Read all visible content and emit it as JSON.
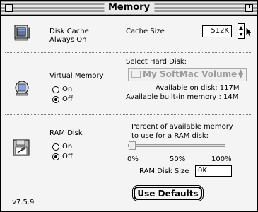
{
  "window": {
    "title": "Memory",
    "version": "v7.5.9"
  },
  "disk_cache": {
    "label_line1": "Disk Cache",
    "label_line2": "Always On",
    "cache_size_label": "Cache Size",
    "cache_size_value": "512K"
  },
  "virtual_memory": {
    "label": "Virtual Memory",
    "on_label": "On",
    "off_label": "Off",
    "selected": "Off",
    "select_disk_label": "Select Hard Disk:",
    "disk_popup_value": "My SoftMac Volume",
    "available_on_disk": "Available on disk:  117M",
    "available_builtin": "Available built-in memory :  14M"
  },
  "ram_disk": {
    "label": "RAM Disk",
    "on_label": "On",
    "off_label": "Off",
    "selected": "Off",
    "percent_label_line1": "Percent of available memory",
    "percent_label_line2": "to use for a RAM disk:",
    "tick_0": "0%",
    "tick_50": "50%",
    "tick_100": "100%",
    "slider_value_percent": 0,
    "size_label": "RAM Disk Size",
    "size_value": "0K"
  },
  "buttons": {
    "use_defaults": "Use Defaults"
  },
  "icons": {
    "disk_cache": "memory-chip-icon",
    "virtual_memory": "hard-disk-icon",
    "ram_disk": "ram-disk-icon",
    "close": "close-box-icon",
    "zoom": "zoom-box-icon",
    "cursor": "arrow-cursor-icon"
  }
}
